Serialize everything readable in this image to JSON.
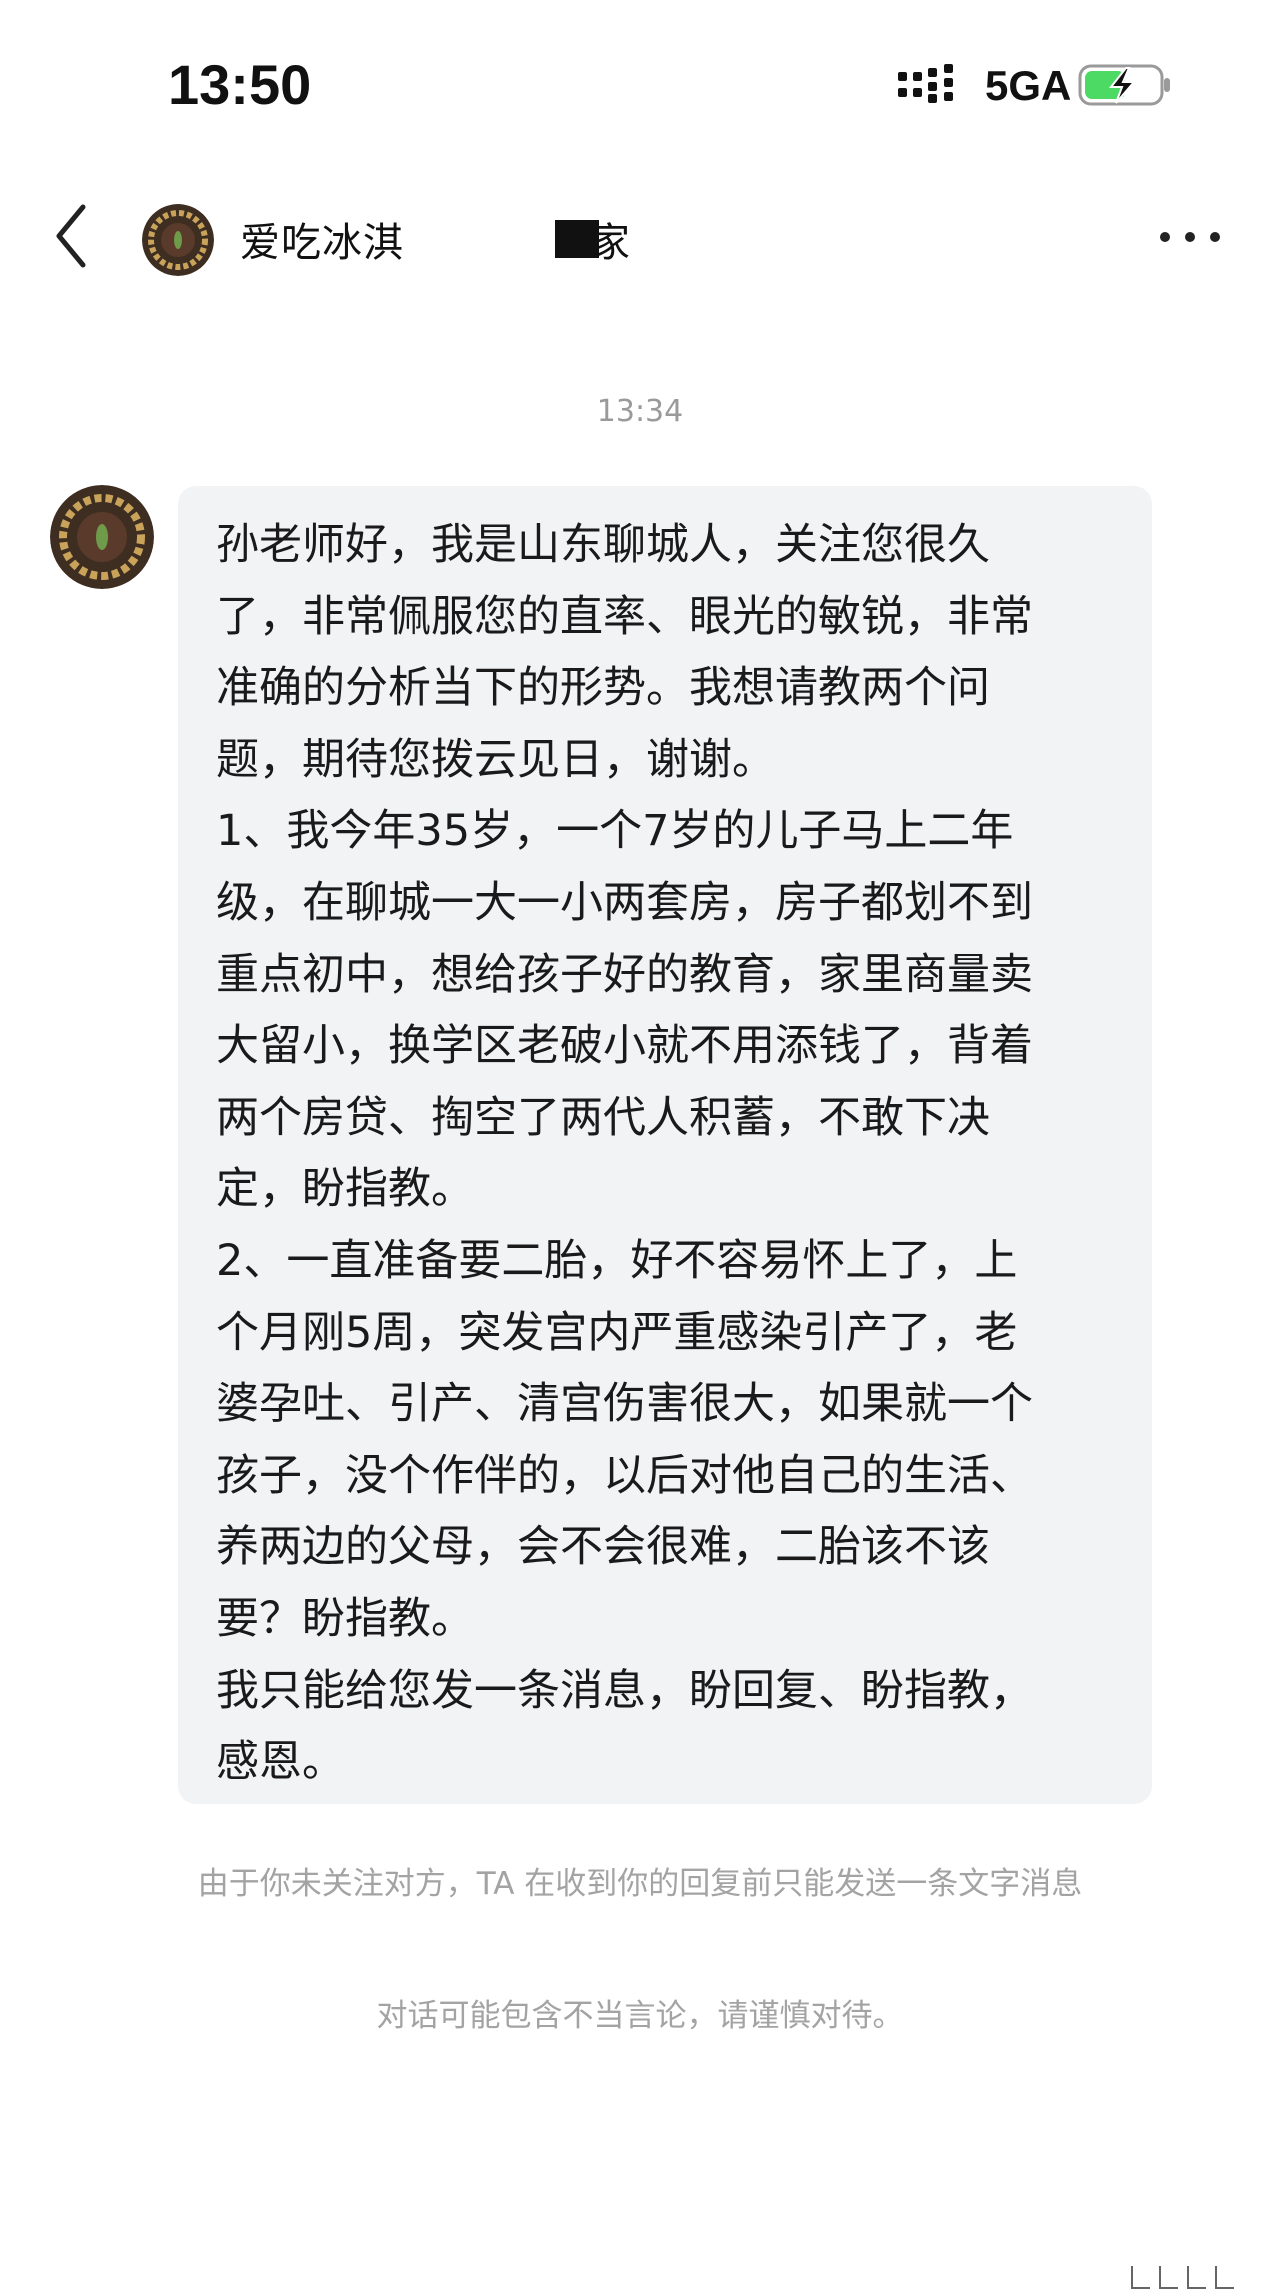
{
  "status_bar": {
    "time": "13:50",
    "network": "5GA"
  },
  "header": {
    "contact_name_visible": "爱吃冰淇",
    "contact_name_tail": "家",
    "icons": {
      "back": "chevron-left-icon",
      "more": "more-dots-icon"
    }
  },
  "conversation": {
    "timestamp": "13:34",
    "message_lines": [
      "孙老师好，我是山东聊城人，关注您很久",
      "了，非常佩服您的直率、眼光的敏锐，非常",
      "准确的分析当下的形势。我想请教两个问",
      "题，期待您拨云见日，谢谢。",
      "1、我今年35岁，一个7岁的儿子马上二年",
      "级，在聊城一大一小两套房，房子都划不到",
      "重点初中，想给孩子好的教育，家里商量卖",
      "大留小，换学区老破小就不用添钱了，背着",
      "两个房贷、掏空了两代人积蓄，不敢下决",
      "定，盼指教。",
      "2、一直准备要二胎，好不容易怀上了，上",
      "个月刚5周，突发宫内严重感染引产了，老",
      "婆孕吐、引产、清宫伤害很大，如果就一个",
      "孩子，没个作伴的，以后对他自己的生活、",
      "养两边的父母，会不会很难，二胎该不该",
      "要？盼指教。",
      "我只能给您发一条消息，盼回复、盼指教，",
      "感恩。"
    ]
  },
  "notices": {
    "system": "由于你未关注对方，TA 在收到你的回复前只能发送一条文字消息",
    "safety": "对话可能包含不当言论，请谨慎对待。"
  },
  "colors": {
    "bubble_bg": "#f2f3f5",
    "battery_green": "#4cd964",
    "muted_text": "#a3a3a3"
  }
}
